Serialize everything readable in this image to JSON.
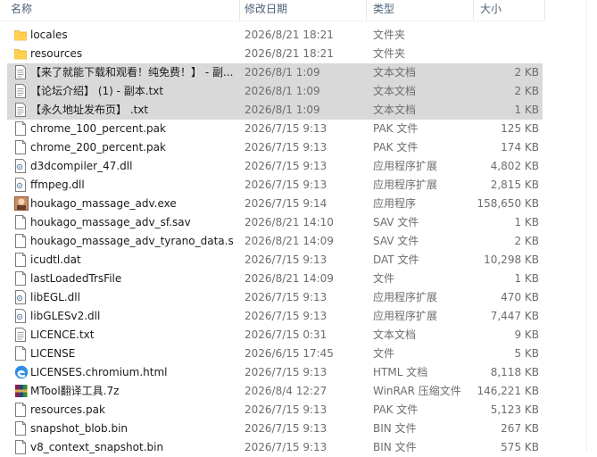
{
  "columns": {
    "name": "名称",
    "modified": "修改日期",
    "type": "类型",
    "size": "大小"
  },
  "files": [
    {
      "name": "locales",
      "modified": "2026/8/21 18:21",
      "type": "文件夹",
      "size": "",
      "icon": "folder-icon",
      "selected": false
    },
    {
      "name": "resources",
      "modified": "2026/8/21 18:21",
      "type": "文件夹",
      "size": "",
      "icon": "folder-icon",
      "selected": false
    },
    {
      "name": "【来了就能下载和观看！纯免费！】 - 副...",
      "modified": "2026/8/1 1:09",
      "type": "文本文档",
      "size": "2 KB",
      "icon": "text-file-icon",
      "selected": true
    },
    {
      "name": "【论坛介绍】 (1) - 副本.txt",
      "modified": "2026/8/1 1:09",
      "type": "文本文档",
      "size": "2 KB",
      "icon": "text-file-icon",
      "selected": true
    },
    {
      "name": "【永久地址发布页】 .txt",
      "modified": "2026/8/1 1:09",
      "type": "文本文档",
      "size": "1 KB",
      "icon": "text-file-icon",
      "selected": true
    },
    {
      "name": "chrome_100_percent.pak",
      "modified": "2026/7/15 9:13",
      "type": "PAK 文件",
      "size": "125 KB",
      "icon": "blank-file-icon",
      "selected": false
    },
    {
      "name": "chrome_200_percent.pak",
      "modified": "2026/7/15 9:13",
      "type": "PAK 文件",
      "size": "174 KB",
      "icon": "blank-file-icon",
      "selected": false
    },
    {
      "name": "d3dcompiler_47.dll",
      "modified": "2026/7/15 9:13",
      "type": "应用程序扩展",
      "size": "4,802 KB",
      "icon": "dll-file-icon",
      "selected": false
    },
    {
      "name": "ffmpeg.dll",
      "modified": "2026/7/15 9:13",
      "type": "应用程序扩展",
      "size": "2,815 KB",
      "icon": "dll-file-icon",
      "selected": false
    },
    {
      "name": "houkago_massage_adv.exe",
      "modified": "2026/7/15 9:14",
      "type": "应用程序",
      "size": "158,650 KB",
      "icon": "app-exe-icon",
      "selected": false
    },
    {
      "name": "houkago_massage_adv_sf.sav",
      "modified": "2026/8/21 14:10",
      "type": "SAV 文件",
      "size": "1 KB",
      "icon": "blank-file-icon",
      "selected": false
    },
    {
      "name": "houkago_massage_adv_tyrano_data.s...",
      "modified": "2026/8/21 14:09",
      "type": "SAV 文件",
      "size": "2 KB",
      "icon": "blank-file-icon",
      "selected": false
    },
    {
      "name": "icudtl.dat",
      "modified": "2026/7/15 9:13",
      "type": "DAT 文件",
      "size": "10,298 KB",
      "icon": "blank-file-icon",
      "selected": false
    },
    {
      "name": "lastLoadedTrsFile",
      "modified": "2026/8/21 14:09",
      "type": "文件",
      "size": "1 KB",
      "icon": "blank-file-icon",
      "selected": false
    },
    {
      "name": "libEGL.dll",
      "modified": "2026/7/15 9:13",
      "type": "应用程序扩展",
      "size": "470 KB",
      "icon": "dll-file-icon",
      "selected": false
    },
    {
      "name": "libGLESv2.dll",
      "modified": "2026/7/15 9:13",
      "type": "应用程序扩展",
      "size": "7,447 KB",
      "icon": "dll-file-icon",
      "selected": false
    },
    {
      "name": "LICENCE.txt",
      "modified": "2026/7/15 0:31",
      "type": "文本文档",
      "size": "9 KB",
      "icon": "text-file-icon",
      "selected": false
    },
    {
      "name": "LICENSE",
      "modified": "2026/6/15 17:45",
      "type": "文件",
      "size": "5 KB",
      "icon": "blank-file-icon",
      "selected": false
    },
    {
      "name": "LICENSES.chromium.html",
      "modified": "2026/7/15 9:13",
      "type": "HTML 文档",
      "size": "8,118 KB",
      "icon": "edge-html-icon",
      "selected": false
    },
    {
      "name": "MTool翻译工具.7z",
      "modified": "2026/8/4 12:27",
      "type": "WinRAR 压缩文件",
      "size": "146,221 KB",
      "icon": "winrar-archive-icon",
      "selected": false
    },
    {
      "name": "resources.pak",
      "modified": "2026/7/15 9:13",
      "type": "PAK 文件",
      "size": "5,123 KB",
      "icon": "blank-file-icon",
      "selected": false
    },
    {
      "name": "snapshot_blob.bin",
      "modified": "2026/7/15 9:13",
      "type": "BIN 文件",
      "size": "267 KB",
      "icon": "blank-file-icon",
      "selected": false
    },
    {
      "name": "v8_context_snapshot.bin",
      "modified": "2026/7/15 9:13",
      "type": "BIN 文件",
      "size": "575 KB",
      "icon": "blank-file-icon",
      "selected": false
    }
  ]
}
